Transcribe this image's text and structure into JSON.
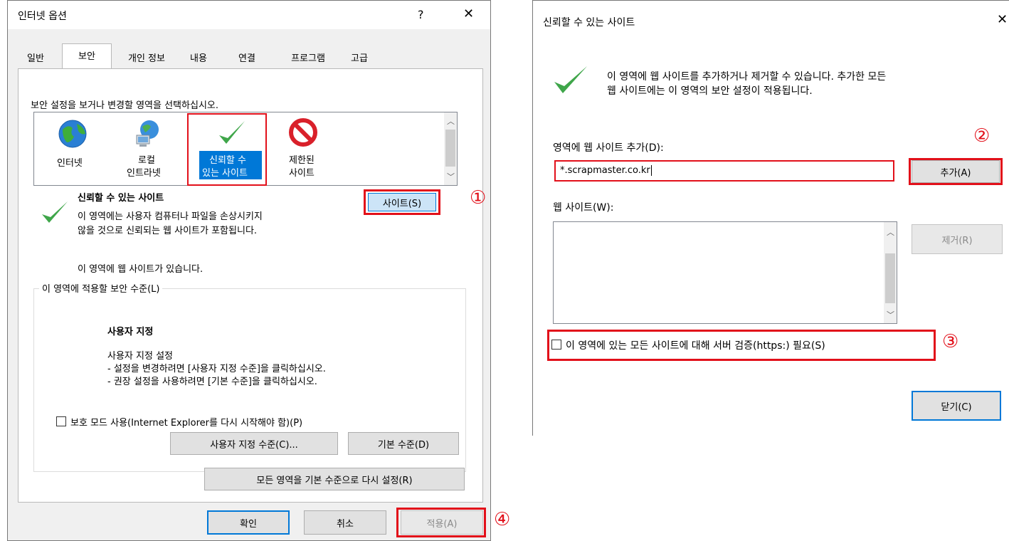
{
  "left_dialog": {
    "title": "인터넷 옵션",
    "help": "?",
    "close": "✕",
    "tabs": [
      "일반",
      "보안",
      "개인 정보",
      "내용",
      "연결",
      "프로그램",
      "고급"
    ],
    "instruction": "보안 설정을 보거나 변경할 영역을 선택하십시오.",
    "zones": [
      {
        "label1": "인터넷",
        "label2": ""
      },
      {
        "label1": "로컬",
        "label2": "인트라넷"
      },
      {
        "label1": "신뢰할 수",
        "label2": "있는 사이트"
      },
      {
        "label1": "제한된",
        "label2": "사이트"
      }
    ],
    "zone_title": "신뢰할 수 있는 사이트",
    "sites_button": "사이트(S)",
    "zone_desc1": "이 영역에는 사용자 컴퓨터나 파일을 손상시키지",
    "zone_desc2": "않을 것으로 신뢰되는 웹 사이트가 포함됩니다.",
    "zone_has_sites": "이 영역에 웹 사이트가 있습니다.",
    "group_label": "이 영역에 적용할 보안 수준(L)",
    "level_title": "사용자 지정",
    "level_line1": "사용자 지정 설정",
    "level_line2": "- 설정을 변경하려면 [사용자 지정 수준]을 클릭하십시오.",
    "level_line3": "- 권장 설정을 사용하려면 [기본 수준]을 클릭하십시오.",
    "protected_mode": "보호 모드 사용(Internet Explorer를 다시 시작해야 함)(P)",
    "custom_level_button": "사용자 지정 수준(C)...",
    "default_level_button": "기본 수준(D)",
    "reset_all_button": "모든 영역을 기본 수준으로 다시 설정(R)",
    "ok_button": "확인",
    "cancel_button": "취소",
    "apply_button": "적용(A)"
  },
  "right_dialog": {
    "title": "신뢰할 수 있는 사이트",
    "close": "✕",
    "info1": "이 영역에 웹 사이트를 추가하거나 제거할 수 있습니다. 추가한 모든",
    "info2": "웹 사이트에는 이 영역의 보안 설정이 적용됩니다.",
    "add_label": "영역에 웹 사이트 추가(D):",
    "add_value": "*.scrapmaster.co.kr",
    "add_button": "추가(A)",
    "websites_label": "웹 사이트(W):",
    "remove_button": "제거(R)",
    "https_check": "이 영역에 있는 모든 사이트에 대해 서버 검증(https:) 필요(S)",
    "close_button": "닫기(C)"
  },
  "callouts": [
    "①",
    "②",
    "③",
    "④"
  ],
  "colors": {
    "highlight": "#e2101a",
    "selection": "#0078d7",
    "accent_button": "#0078d7"
  }
}
